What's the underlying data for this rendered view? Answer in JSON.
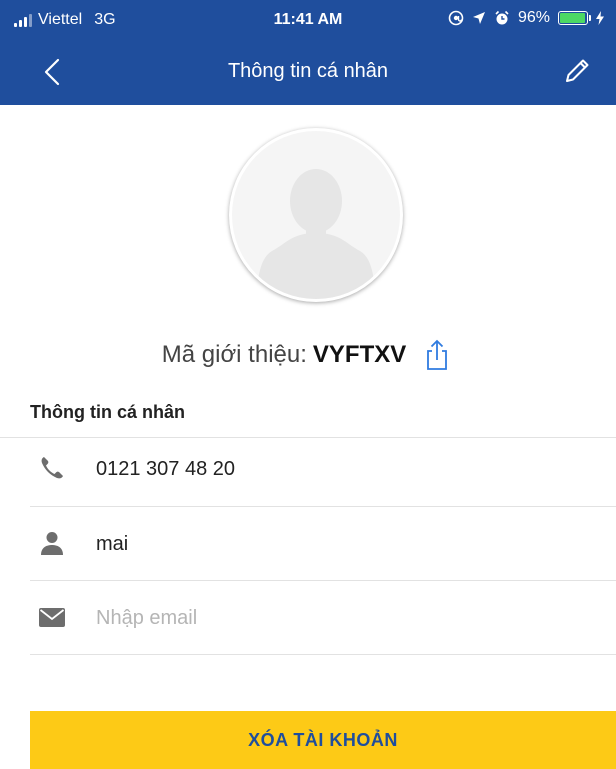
{
  "status_bar": {
    "carrier": "Viettel",
    "network": "3G",
    "time": "11:41 AM",
    "battery": "96%",
    "battery_level": 0.96,
    "icons": [
      "signal-icon",
      "at-icon",
      "location-icon",
      "alarm-icon",
      "battery-icon",
      "charging-icon"
    ]
  },
  "nav": {
    "title": "Thông tin cá nhân",
    "back_icon": "chevron-left-icon",
    "edit_icon": "pencil-icon"
  },
  "profile": {
    "avatar_icon": "person-silhouette-icon",
    "referral_label": "Mã giới thiệu:",
    "referral_code": "VYFTXV",
    "share_icon": "share-icon"
  },
  "info": {
    "section_title": "Thông tin cá nhân",
    "phone": "0121 307 48 20",
    "name": "mai",
    "email_value": "",
    "email_placeholder": "Nhập email"
  },
  "actions": {
    "delete_label": "XÓA TÀI KHOẢN"
  },
  "colors": {
    "header": "#1f4e9d",
    "button": "#fdca16",
    "button_text": "#1f4e9d",
    "icon_gray": "#6d6d6d",
    "share_blue": "#2f7be0"
  }
}
